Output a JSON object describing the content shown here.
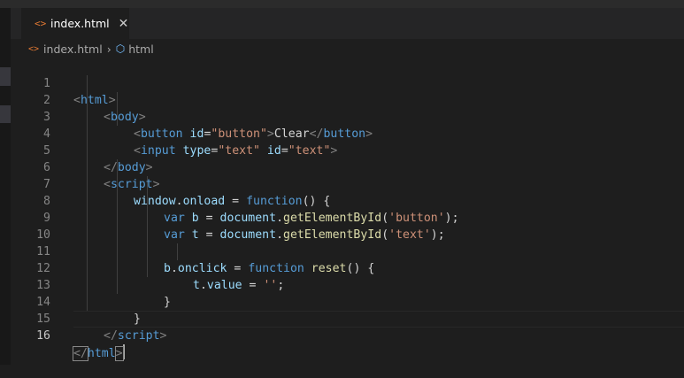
{
  "tab": {
    "label": "index.html",
    "close_glyph": "✕",
    "icon": "html-file-icon"
  },
  "breadcrumb": {
    "file": "index.html",
    "separator": "›",
    "element": "html"
  },
  "line_numbers": [
    "1",
    "2",
    "3",
    "4",
    "5",
    "6",
    "7",
    "8",
    "9",
    "10",
    "11",
    "12",
    "13",
    "14",
    "15",
    "16"
  ],
  "code": {
    "l1": {
      "open": "<",
      "tag": "html",
      "close": ">"
    },
    "l2": {
      "open": "<",
      "tag": "body",
      "close": ">"
    },
    "l3": {
      "open": "<",
      "tag": "button",
      "attr": "id",
      "eq": "=",
      "val": "\"button\"",
      "close": ">",
      "text": "Clear",
      "open2": "</",
      "tag2": "button",
      "close2": ">"
    },
    "l4": {
      "open": "<",
      "tag": "input",
      "attr1": "type",
      "eq1": "=",
      "val1": "\"text\"",
      "attr2": "id",
      "eq2": "=",
      "val2": "\"text\"",
      "close": ">"
    },
    "l5": {
      "open": "</",
      "tag": "body",
      "close": ">"
    },
    "l6": {
      "open": "<",
      "tag": "script",
      "close": ">"
    },
    "l7": {
      "obj": "window",
      "dot": ".",
      "prop": "onload",
      "eq": " = ",
      "kw": "function",
      "rest": "() {"
    },
    "l8": {
      "kw": "var",
      "v": " b",
      "eq": " = ",
      "obj": "document",
      "dot": ".",
      "fn": "getElementById",
      "p1": "(",
      "str": "'button'",
      "p2": ");"
    },
    "l9": {
      "kw": "var",
      "v": " t",
      "eq": " = ",
      "obj": "document",
      "dot": ".",
      "fn": "getElementById",
      "p1": "(",
      "str": "'text'",
      "p2": ");"
    },
    "l11": {
      "obj": "b",
      "dot": ".",
      "prop": "onclick",
      "eq": " = ",
      "kw": "function",
      "sp": " ",
      "fn": "reset",
      "rest": "() {"
    },
    "l12": {
      "obj": "t",
      "dot": ".",
      "prop": "value",
      "eq": " = ",
      "str": "''",
      "semi": ";"
    },
    "l13": {
      "text": "}"
    },
    "l14": {
      "text": "}"
    },
    "l15": {
      "open": "</",
      "tag": "script",
      "close": ">"
    },
    "l16": {
      "open": "</",
      "tag": "html",
      "close": ">"
    }
  }
}
